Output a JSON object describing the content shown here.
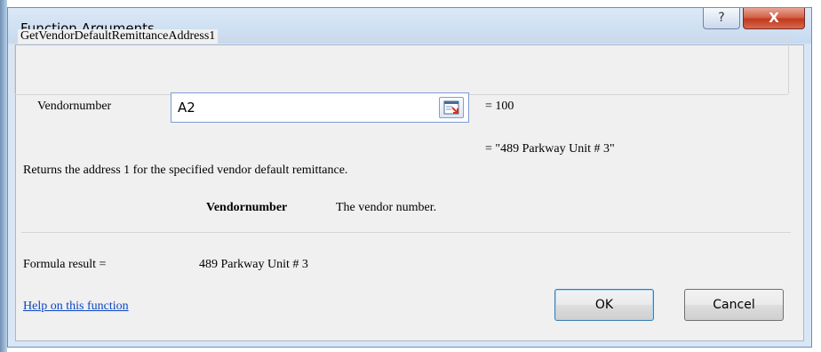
{
  "window": {
    "title": "Function Arguments",
    "help_glyph": "?",
    "close_glyph": "X"
  },
  "function": {
    "name": "GetVendorDefaultRemittanceAddress1",
    "argument_label": "Vendornumber",
    "argument_input": "A2",
    "argument_value": "=  100",
    "result_preview": "=  \"489 Parkway Unit # 3\"",
    "description": "Returns the address 1 for the specified vendor default remittance.",
    "param_name": "Vendornumber",
    "param_description": "The vendor number."
  },
  "formula": {
    "label": "Formula result =",
    "value": "489 Parkway Unit # 3"
  },
  "footer": {
    "help_link": "Help on this function",
    "ok_label": "OK",
    "cancel_label": "Cancel"
  },
  "icons": {
    "help": "question-icon",
    "close": "close-icon",
    "collapse": "collapse-dialog-icon"
  },
  "colors": {
    "link": "#0a45c4",
    "close_button": "#c0391c",
    "titlebar": "#c6daf0"
  }
}
